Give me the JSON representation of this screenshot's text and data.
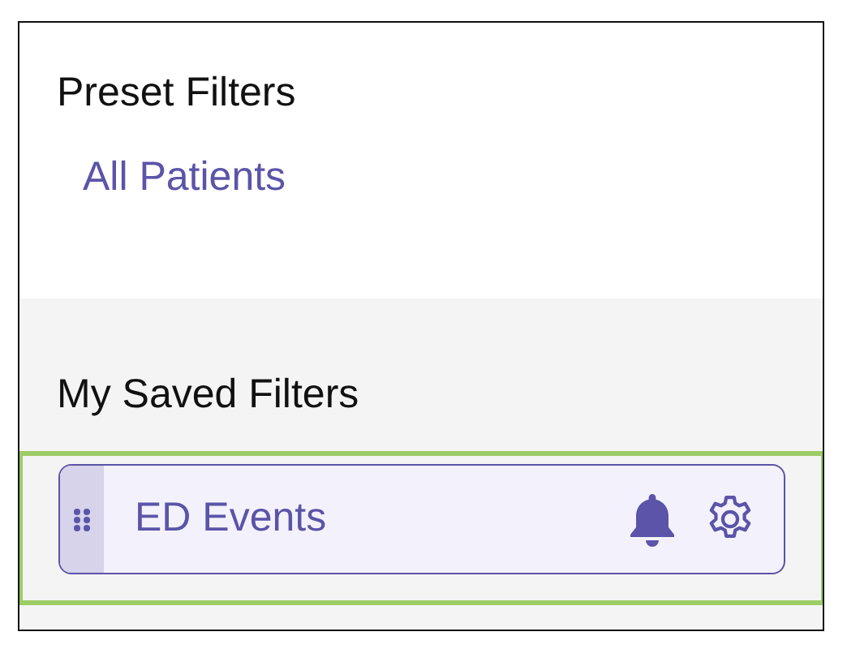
{
  "preset_filters": {
    "title": "Preset Filters",
    "items": [
      {
        "label": "All Patients"
      }
    ]
  },
  "saved_filters": {
    "title": "My Saved Filters",
    "items": [
      {
        "label": "ED Events",
        "highlighted": true,
        "notifications": true
      }
    ]
  }
}
